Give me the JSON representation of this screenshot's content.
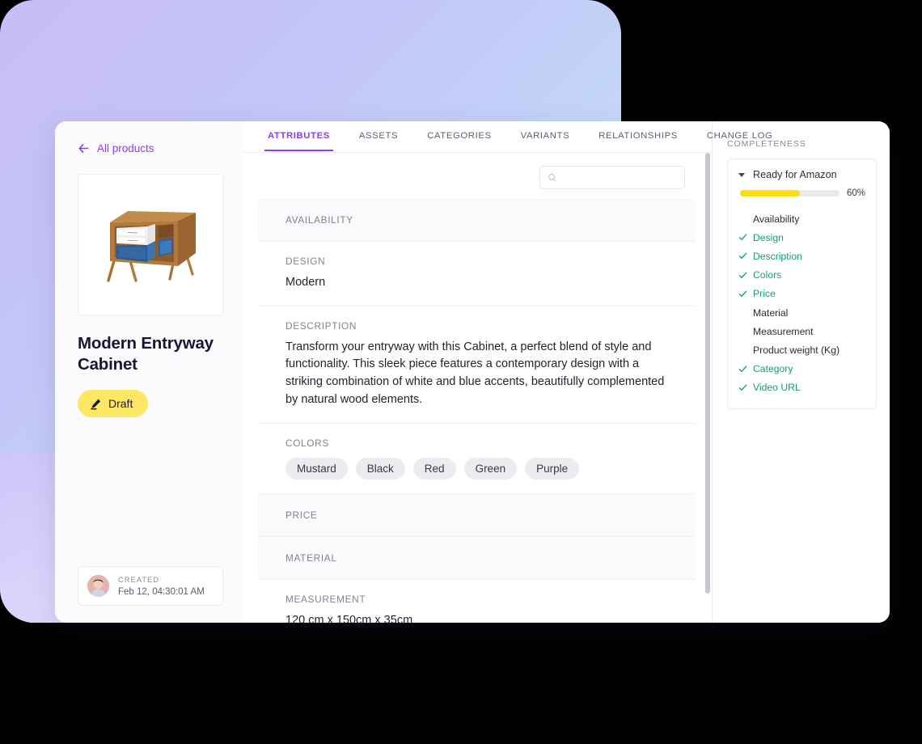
{
  "backdrop": {
    "gradient_from": "#c9bdf7",
    "gradient_to": "#cfe2fb"
  },
  "sidebar": {
    "back_link": "All products",
    "back_icon": "arrow-left-icon",
    "product_image_alt": "Modern entryway cabinet with wood frame, white and blue compartments",
    "product_title": "Modern Entryway Cabinet",
    "status_badge": {
      "label": "Draft",
      "icon": "pencil-icon",
      "color": "#ffe766"
    },
    "created": {
      "label": "CREATED",
      "date": "Feb 12, 04:30:01 AM",
      "avatar": "user-avatar"
    }
  },
  "tabs": [
    {
      "label": "ATTRIBUTES",
      "active": true
    },
    {
      "label": "ASSETS",
      "active": false
    },
    {
      "label": "CATEGORIES",
      "active": false
    },
    {
      "label": "VARIANTS",
      "active": false
    },
    {
      "label": "RELATIONSHIPS",
      "active": false
    },
    {
      "label": "CHANGE LOG",
      "active": false
    }
  ],
  "search": {
    "value": "",
    "placeholder": "",
    "icon": "search-icon"
  },
  "attributes": [
    {
      "label": "AVAILABILITY",
      "value": "",
      "type": "empty"
    },
    {
      "label": "DESIGN",
      "value": "Modern",
      "type": "text"
    },
    {
      "label": "DESCRIPTION",
      "value": "Transform your entryway with this Cabinet, a perfect blend of style and functionality. This sleek piece features a contemporary design with a striking combination of white and blue accents, beautifully complemented by natural wood elements.",
      "type": "text"
    },
    {
      "label": "COLORS",
      "value": "",
      "type": "chips",
      "chips": [
        "Mustard",
        "Black",
        "Red",
        "Green",
        "Purple"
      ]
    },
    {
      "label": "PRICE",
      "value": "",
      "type": "empty"
    },
    {
      "label": "MATERIAL",
      "value": "",
      "type": "empty"
    },
    {
      "label": "MEASUREMENT",
      "value": "120 cm x 150cm x 35cm",
      "type": "text"
    }
  ],
  "completeness": {
    "title": "COMPLETENESS",
    "group_name": "Ready for Amazon",
    "percent_label": "60%",
    "percent_value": 60,
    "bar_color": "#fcdc12",
    "done_color": "#14a06a",
    "items": [
      {
        "label": "Availability",
        "done": false
      },
      {
        "label": "Design",
        "done": true
      },
      {
        "label": "Description",
        "done": true
      },
      {
        "label": "Colors",
        "done": true
      },
      {
        "label": "Price",
        "done": true
      },
      {
        "label": "Material",
        "done": false
      },
      {
        "label": "Measurement",
        "done": false
      },
      {
        "label": "Product weight (Kg)",
        "done": false
      },
      {
        "label": "Category",
        "done": true
      },
      {
        "label": "Video URL",
        "done": true
      }
    ]
  }
}
